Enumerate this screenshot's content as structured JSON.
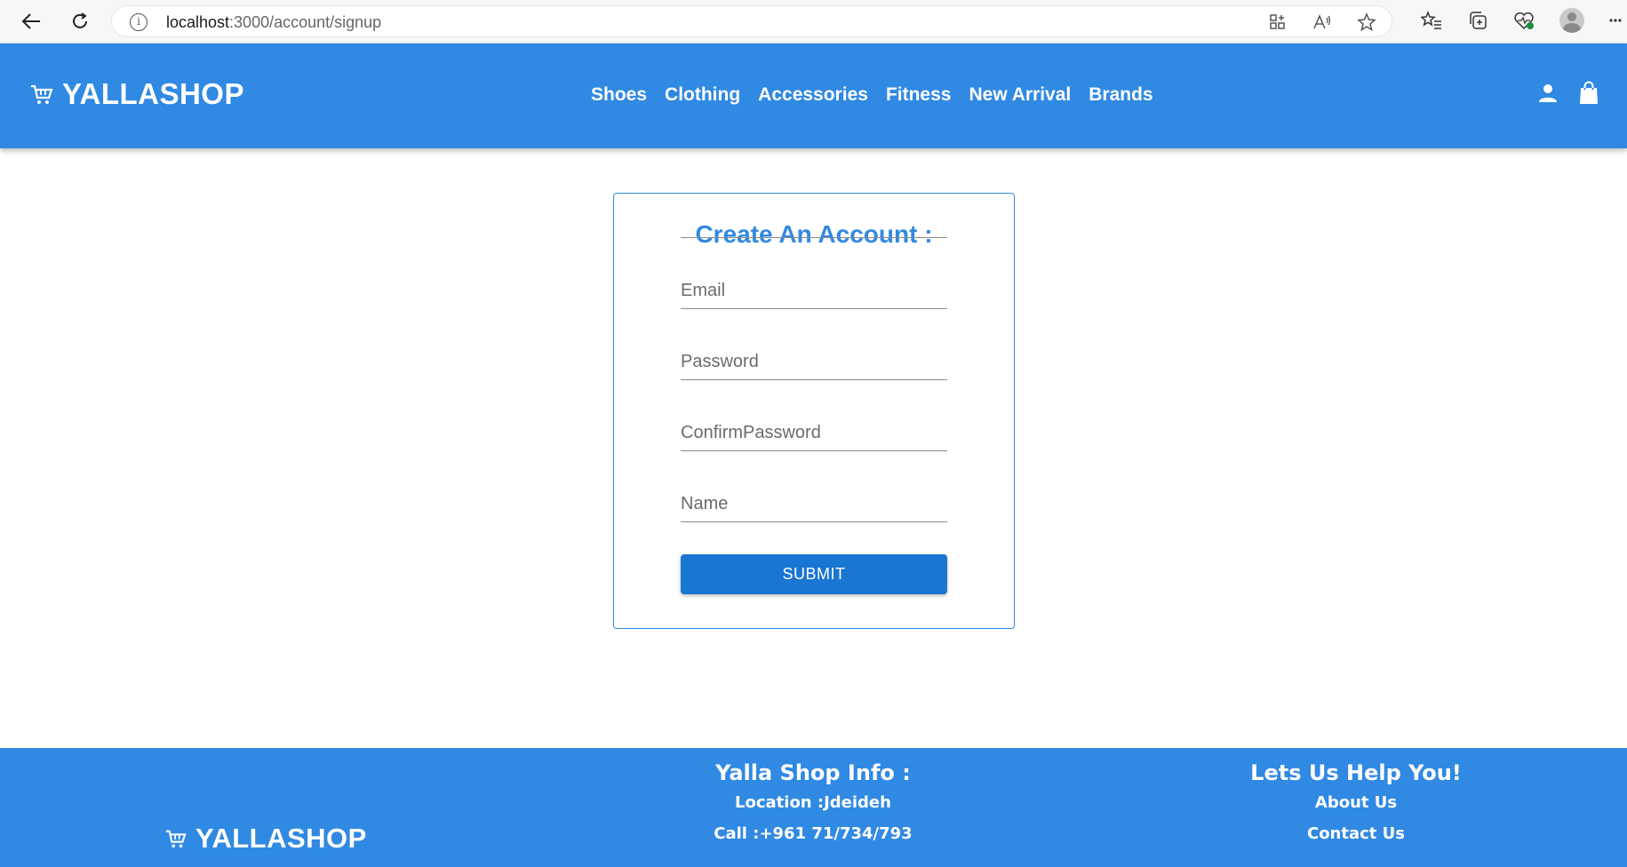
{
  "browser": {
    "url_host": "localhost",
    "url_path": ":3000/account/signup"
  },
  "header": {
    "logo": "YALLASHOP",
    "nav": [
      "Shoes",
      "Clothing",
      "Accessories",
      "Fitness",
      "New Arrival",
      "Brands"
    ]
  },
  "form": {
    "title": "Create An Account :",
    "email_placeholder": "Email",
    "password_placeholder": "Password",
    "confirm_placeholder": "ConfirmPassword",
    "name_placeholder": "Name",
    "submit_label": "SUBMIT"
  },
  "footer": {
    "logo": "YALLASHOP",
    "info_title": "Yalla Shop Info :",
    "info_items": [
      "Location :Jdeideh",
      "Call :+961 71/734/793"
    ],
    "help_title": "Lets Us Help You!",
    "help_items": [
      "About Us",
      "Contact Us"
    ]
  },
  "colors": {
    "brand": "#3089e3",
    "button": "#1976d2"
  }
}
